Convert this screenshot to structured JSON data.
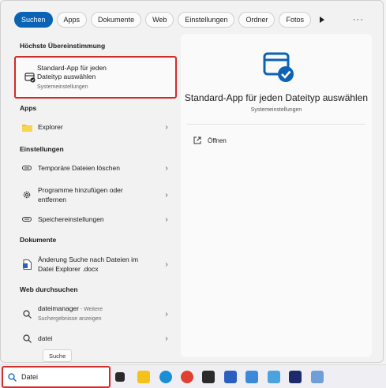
{
  "tabs": [
    "Suchen",
    "Apps",
    "Dokumente",
    "Web",
    "Einstellungen",
    "Ordner",
    "Fotos"
  ],
  "best_match": {
    "section": "Höchste Übereinstimmung",
    "title": "Standard-App für jeden Dateityp auswählen",
    "title_line1": "Standard-App für jeden",
    "title_line2": "Dateityp auswählen",
    "subtitle": "Systemeinstellungen"
  },
  "sections": {
    "apps": "Apps",
    "settings": "Einstellungen",
    "documents": "Dokumente",
    "web": "Web durchsuchen"
  },
  "apps": [
    {
      "label": "Explorer",
      "icon": "folder-icon"
    }
  ],
  "settings": [
    {
      "label": "Temporäre Dateien löschen",
      "icon": "storage-icon"
    },
    {
      "label_line1": "Programme hinzufügen oder",
      "label_line2": "entfernen",
      "icon": "gear-icon"
    },
    {
      "label": "Speichereinstellungen",
      "icon": "storage-icon"
    }
  ],
  "documents": [
    {
      "label_line1": "Änderung Suche nach Dateien im",
      "label_line2": "Datei Explorer .docx",
      "icon": "document-icon"
    }
  ],
  "web": [
    {
      "label": "dateimanager",
      "suffix": " - Weitere",
      "sub": "Suchergebnisse anzeigen",
      "icon": "search-icon"
    },
    {
      "label": "datei",
      "icon": "search-icon"
    }
  ],
  "detail": {
    "title": "Standard-App für jeden Dateityp auswählen",
    "subtitle": "Systemeinstellungen",
    "action": "Öffnen"
  },
  "tooltip": "Suche",
  "search": {
    "value": "Datei"
  },
  "colors": {
    "accent": "#0b63b5",
    "highlight_border": "#d12b2b"
  }
}
